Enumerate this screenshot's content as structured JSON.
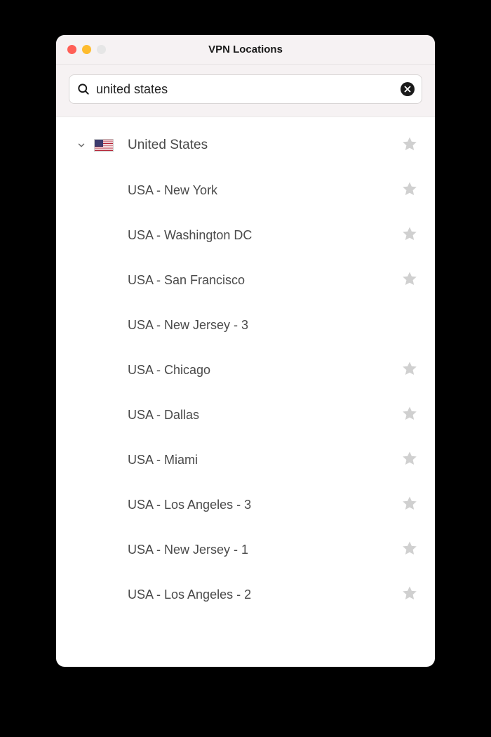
{
  "window": {
    "title": "VPN Locations"
  },
  "search": {
    "value": "united states"
  },
  "country": {
    "name": "United States",
    "flag": "us"
  },
  "locations": [
    {
      "label": "USA - New York"
    },
    {
      "label": "USA - Washington DC"
    },
    {
      "label": "USA - San Francisco"
    },
    {
      "label": "USA - New Jersey - 3"
    },
    {
      "label": "USA - Chicago"
    },
    {
      "label": "USA - Dallas"
    },
    {
      "label": "USA - Miami"
    },
    {
      "label": "USA - Los Angeles - 3"
    },
    {
      "label": "USA - New Jersey - 1"
    },
    {
      "label": "USA - Los Angeles - 2"
    }
  ]
}
